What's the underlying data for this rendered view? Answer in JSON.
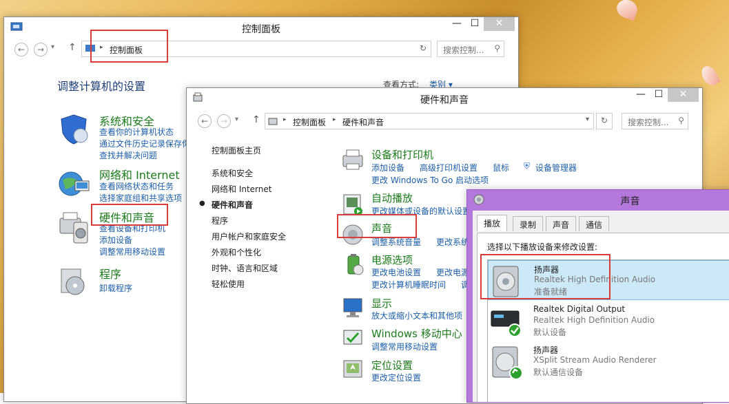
{
  "control_panel": {
    "title": "控制面板",
    "address": "控制面板",
    "search_placeholder": "搜索控制...",
    "heading": "调整计算机的设置",
    "view_by_label": "查看方式:",
    "view_by_value": "类别 ▾",
    "categories": [
      {
        "title": "系统和安全",
        "links": [
          "查看你的计算机状态",
          "通过文件历史记录保存你",
          "查找并解决问题"
        ]
      },
      {
        "title": "网络和 Internet",
        "links": [
          "查看网络状态和任务",
          "选择家庭组和共享选项"
        ]
      },
      {
        "title": "硬件和声音",
        "links": [
          "查看设备和打印机",
          "添加设备",
          "调整常用移动设置"
        ]
      },
      {
        "title": "程序",
        "links": [
          "卸载程序"
        ]
      }
    ]
  },
  "hardware_sound": {
    "title": "硬件和声音",
    "breadcrumb": [
      "控制面板",
      "硬件和声音"
    ],
    "search_placeholder": "搜索控制...",
    "sidebar": [
      "控制面板主页",
      "系统和安全",
      "网络和 Internet",
      "硬件和声音",
      "程序",
      "用户帐户和家庭安全",
      "外观和个性化",
      "时钟、语言和区域",
      "轻松使用"
    ],
    "sections": [
      {
        "title": "设备和打印机",
        "links": [
          "添加设备",
          "高级打印机设置",
          "鼠标",
          "设备管理器",
          "更改 Windows To Go 启动选项"
        ]
      },
      {
        "title": "自动播放",
        "links": [
          "更改媒体或设备的默认设置"
        ]
      },
      {
        "title": "声音",
        "links": [
          "调整系统音量",
          "更改系统"
        ]
      },
      {
        "title": "电源选项",
        "links": [
          "更改电池设置",
          "更改电源",
          "更改计算机睡眠时间",
          "调"
        ]
      },
      {
        "title": "显示",
        "links": [
          "放大或缩小文本和其他项"
        ]
      },
      {
        "title": "Windows 移动中心",
        "links": [
          "调整常用移动设置"
        ]
      },
      {
        "title": "定位设置",
        "links": [
          "更改定位设置"
        ]
      }
    ]
  },
  "sound_dialog": {
    "title": "声音",
    "tabs": [
      "播放",
      "录制",
      "声音",
      "通信"
    ],
    "instruction": "选择以下播放设备来修改设置:",
    "devices": [
      {
        "name": "扬声器",
        "driver": "Realtek High Definition Audio",
        "status": "准备就绪"
      },
      {
        "name": "Realtek Digital Output",
        "driver": "Realtek High Definition Audio",
        "status": "默认设备"
      },
      {
        "name": "扬声器",
        "driver": "XSplit  Stream  Audio  Renderer",
        "status": "默认通信设备"
      }
    ]
  },
  "window_buttons": {
    "minimize": "—",
    "maximize": "☐",
    "close": "✕"
  }
}
